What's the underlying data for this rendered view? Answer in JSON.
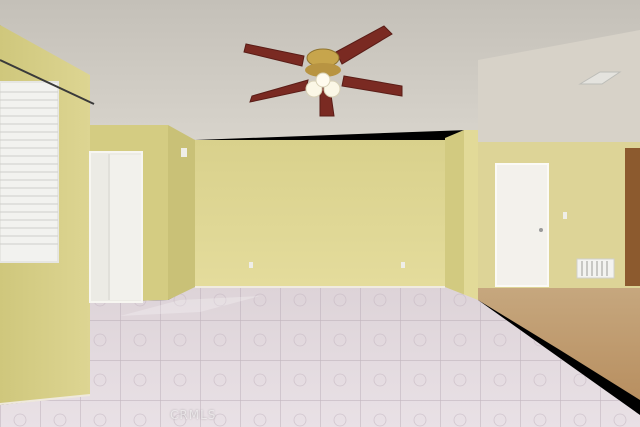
{
  "scene": {
    "description_tags": [
      "empty-room",
      "ceiling-fan",
      "tile-floor",
      "laminate-floor",
      "doors",
      "window-blinds"
    ],
    "colors": {
      "ceiling": "#cdc9c1",
      "wall_yellow": "#dcd48e",
      "wall_shadow": "#bdb56e",
      "tile_light": "#e6dfe6",
      "tile_grout": "#a99aa6",
      "laminate": "#c9a77c",
      "door_white": "#f1efe9",
      "fan_blade": "#7a2a22",
      "fan_brass": "#c7a54c"
    }
  },
  "watermark": {
    "text": "CRMLS"
  }
}
